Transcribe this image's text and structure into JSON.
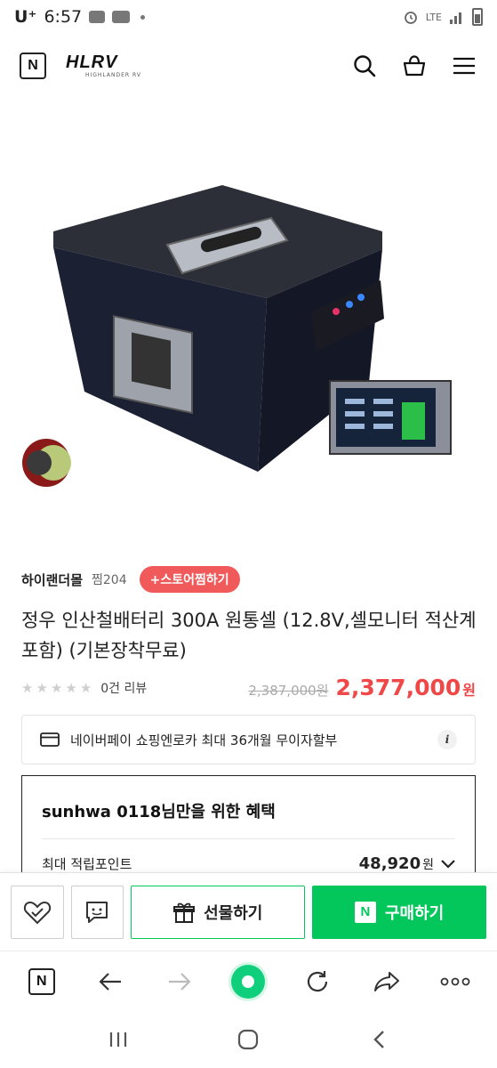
{
  "status_bar": {
    "carrier": "U⁺",
    "time": "6:57",
    "network": "LTE"
  },
  "header": {
    "logo_letter": "N",
    "brand_name": "HLRV",
    "brand_subtitle": "HIGHLANDER RV"
  },
  "product": {
    "store_name": "하이랜더몰",
    "store_fav": "찜204",
    "store_fav_button": "+스토어찜하기",
    "title": "정우 인산철배터리 300A 원통셀 (12.8V,셀모니터 적산계 포함) (기본장착무료)",
    "review_count": "0건 리뷰",
    "original_price": "2,387,000원",
    "sale_price": "2,377,000",
    "price_unit": "원",
    "rating_stars": 0
  },
  "npay_banner": {
    "text": "네이버페이 쇼핑엔로카 최대 36개월 무이자할부",
    "info_label": "i"
  },
  "benefit": {
    "title": "sunhwa 0118님만을 위한 혜택",
    "row_label": "최대 적립포인트",
    "row_value": "48,920",
    "row_unit": "원"
  },
  "purchase_bar": {
    "gift_label": "선물하기",
    "buy_label": "구매하기",
    "buy_n": "N"
  },
  "browser": {
    "home_letter": "N"
  },
  "colors": {
    "accent_green": "#03c75a",
    "price_red": "#f04848",
    "brand_red": "#d0182a"
  }
}
